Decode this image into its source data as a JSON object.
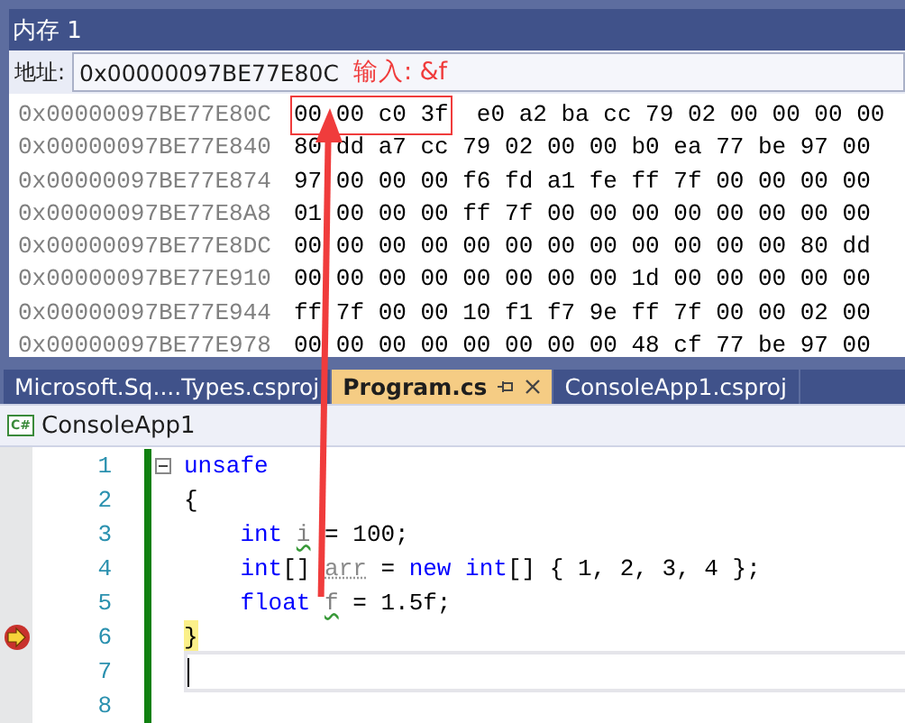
{
  "window": {
    "title": "内存 1"
  },
  "address_bar": {
    "label": "地址:",
    "value": "0x00000097BE77E80C",
    "annotation": "输入: &f"
  },
  "memory_rows": [
    {
      "address": "0x00000097BE77E80C",
      "boxed": [
        "00",
        "00",
        "c0",
        "3f"
      ],
      "bytes": [
        "e0",
        "a2",
        "ba",
        "cc",
        "79",
        "02",
        "00",
        "00",
        "00",
        "00"
      ]
    },
    {
      "address": "0x00000097BE77E840",
      "bytes": [
        "80",
        "dd",
        "a7",
        "cc",
        "79",
        "02",
        "00",
        "00",
        "b0",
        "ea",
        "77",
        "be",
        "97",
        "00"
      ]
    },
    {
      "address": "0x00000097BE77E874",
      "bytes": [
        "97",
        "00",
        "00",
        "00",
        "f6",
        "fd",
        "a1",
        "fe",
        "ff",
        "7f",
        "00",
        "00",
        "00",
        "00"
      ]
    },
    {
      "address": "0x00000097BE77E8A8",
      "bytes": [
        "01",
        "00",
        "00",
        "00",
        "ff",
        "7f",
        "00",
        "00",
        "00",
        "00",
        "00",
        "00",
        "00",
        "00"
      ]
    },
    {
      "address": "0x00000097BE77E8DC",
      "bytes": [
        "00",
        "00",
        "00",
        "00",
        "00",
        "00",
        "00",
        "00",
        "00",
        "00",
        "00",
        "00",
        "80",
        "dd"
      ]
    },
    {
      "address": "0x00000097BE77E910",
      "bytes": [
        "00",
        "00",
        "00",
        "00",
        "00",
        "00",
        "00",
        "00",
        "1d",
        "00",
        "00",
        "00",
        "00",
        "00"
      ]
    },
    {
      "address": "0x00000097BE77E944",
      "bytes": [
        "ff",
        "7f",
        "00",
        "00",
        "10",
        "f1",
        "f7",
        "9e",
        "ff",
        "7f",
        "00",
        "00",
        "02",
        "00"
      ]
    },
    {
      "address": "0x00000097BE77E978",
      "bytes": [
        "00",
        "00",
        "00",
        "00",
        "00",
        "00",
        "00",
        "00",
        "48",
        "cf",
        "77",
        "be",
        "97",
        "00"
      ]
    }
  ],
  "tabs": [
    {
      "label": "Microsoft.Sq....Types.csproj",
      "selected": false
    },
    {
      "label": "Program.cs",
      "selected": true
    },
    {
      "label": "ConsoleApp1.csproj",
      "selected": false
    }
  ],
  "navigation": {
    "badge": "C#",
    "project": "ConsoleApp1"
  },
  "code_lines": [
    {
      "number": "1",
      "collapsible": true,
      "current": false,
      "caret": false,
      "tokens": [
        {
          "text": "unsafe",
          "kind": "keyword"
        }
      ]
    },
    {
      "number": "2",
      "collapsible": false,
      "current": false,
      "caret": false,
      "tokens": [
        {
          "text": "{",
          "kind": "plain"
        }
      ]
    },
    {
      "number": "3",
      "collapsible": false,
      "current": false,
      "caret": false,
      "tokens": [
        {
          "text": "    int ",
          "kind": "keyword"
        },
        {
          "text": "i",
          "kind": "warning"
        },
        {
          "text": " = 100;",
          "kind": "plain"
        }
      ]
    },
    {
      "number": "4",
      "collapsible": false,
      "current": false,
      "caret": false,
      "tokens": [
        {
          "text": "    int",
          "kind": "keyword"
        },
        {
          "text": "[] ",
          "kind": "plain"
        },
        {
          "text": "arr",
          "kind": "unused"
        },
        {
          "text": " = ",
          "kind": "plain"
        },
        {
          "text": "new ",
          "kind": "keyword"
        },
        {
          "text": "int",
          "kind": "keyword"
        },
        {
          "text": "[] { 1, 2, 3, 4 };",
          "kind": "plain"
        }
      ]
    },
    {
      "number": "5",
      "collapsible": false,
      "current": false,
      "caret": false,
      "tokens": [
        {
          "text": "    float ",
          "kind": "keyword"
        },
        {
          "text": "f",
          "kind": "warning"
        },
        {
          "text": " = 1.5f;",
          "kind": "plain"
        }
      ]
    },
    {
      "number": "6",
      "collapsible": false,
      "current": true,
      "caret": false,
      "tokens": [
        {
          "text": "}",
          "kind": "plain"
        }
      ]
    },
    {
      "number": "7",
      "collapsible": false,
      "current": false,
      "caret": true
    },
    {
      "number": "8",
      "collapsible": false,
      "current": false,
      "caret": false
    }
  ]
}
